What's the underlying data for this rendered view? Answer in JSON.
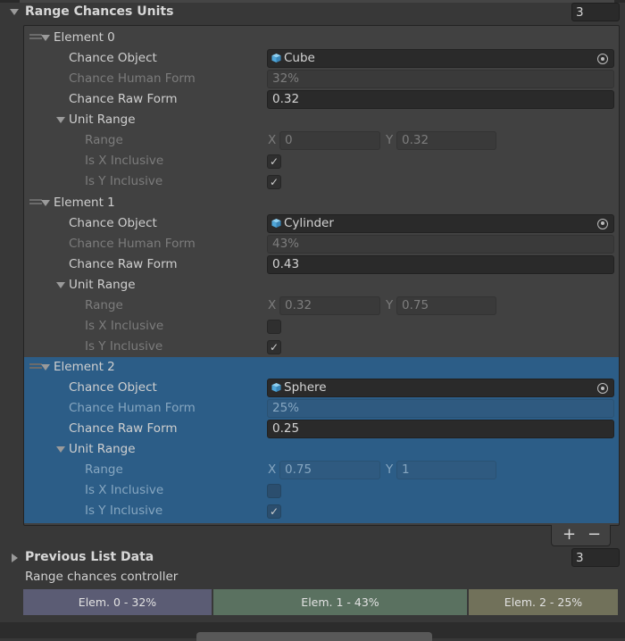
{
  "range_chances_units": {
    "label": "Range Chances Units",
    "count": "3"
  },
  "field_labels": {
    "chance_object": "Chance Object",
    "chance_human_form": "Chance Human Form",
    "chance_raw_form": "Chance Raw Form",
    "unit_range": "Unit Range",
    "range": "Range",
    "is_x_inclusive": "Is X Inclusive",
    "is_y_inclusive": "Is Y Inclusive",
    "x": "X",
    "y": "Y"
  },
  "elements": [
    {
      "label": "Element 0",
      "chance_object": "Cube",
      "human_form": "32%",
      "raw_form": "0.32",
      "range_x": "0",
      "range_y": "0.32",
      "is_x_inclusive": true,
      "is_y_inclusive": true,
      "selected": false
    },
    {
      "label": "Element 1",
      "chance_object": "Cylinder",
      "human_form": "43%",
      "raw_form": "0.43",
      "range_x": "0.32",
      "range_y": "0.75",
      "is_x_inclusive": false,
      "is_y_inclusive": true,
      "selected": false
    },
    {
      "label": "Element 2",
      "chance_object": "Sphere",
      "human_form": "25%",
      "raw_form": "0.25",
      "range_x": "0.75",
      "range_y": "1",
      "is_x_inclusive": false,
      "is_y_inclusive": true,
      "selected": true
    }
  ],
  "list_buttons": {
    "add": "+",
    "remove": "−"
  },
  "previous_list_data": {
    "label": "Previous List Data",
    "count": "3"
  },
  "controller": {
    "title": "Range chances controller",
    "segments": [
      {
        "label": "Elem. 0 - 32%",
        "fraction": 0.32,
        "color": "#5b5c74"
      },
      {
        "label": "Elem. 1 - 43%",
        "fraction": 0.43,
        "color": "#5a7160"
      },
      {
        "label": "Elem. 2 - 25%",
        "fraction": 0.25,
        "color": "#71715a"
      }
    ]
  },
  "icons": {
    "foldout_open": "triangle-down-icon",
    "foldout_closed": "triangle-right-icon",
    "object": "cube-icon",
    "picker": "object-picker-icon",
    "drag": "drag-handle-icon",
    "check": "checkmark-icon"
  },
  "colors": {
    "background": "#383838",
    "selection": "#2c5d87",
    "field": "#2a2a2a",
    "cube_icon": "#5ab4e6"
  }
}
